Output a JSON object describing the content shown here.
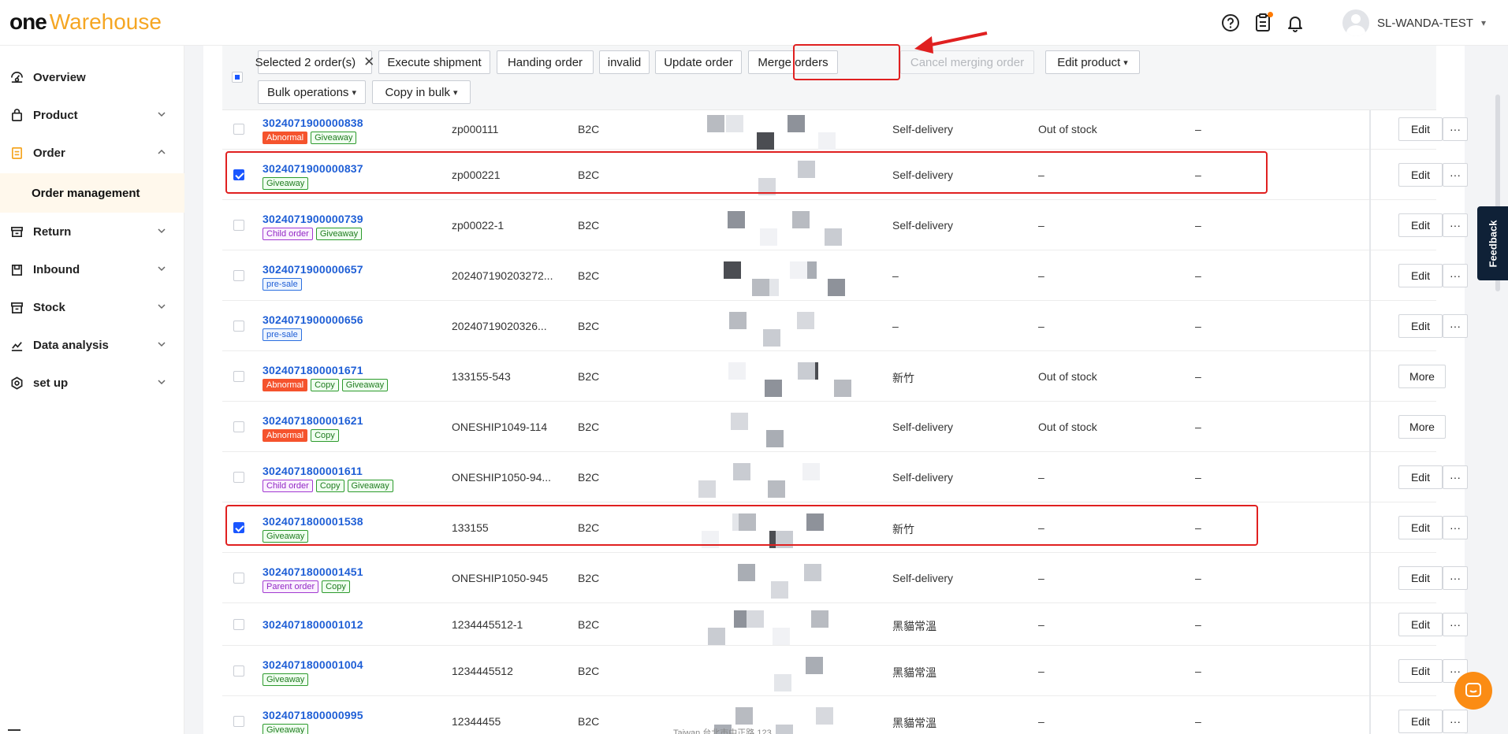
{
  "header": {
    "logo_one": "one",
    "logo_warehouse": "Warehouse",
    "user_name": "SL-WANDA-TEST"
  },
  "sidebar": {
    "items": [
      {
        "label": "Overview",
        "icon": "dashboard-icon"
      },
      {
        "label": "Product",
        "icon": "bag-icon"
      },
      {
        "label": "Order",
        "icon": "document-icon"
      },
      {
        "label": "Return",
        "icon": "return-box-icon"
      },
      {
        "label": "Inbound",
        "icon": "inbound-icon"
      },
      {
        "label": "Stock",
        "icon": "stock-icon"
      },
      {
        "label": "Data analysis",
        "icon": "chart-icon"
      },
      {
        "label": "set up",
        "icon": "gear-icon"
      }
    ],
    "sub_item": "Order management"
  },
  "toolbar": {
    "selected": "Selected 2 order(s)",
    "execute": "Execute shipment",
    "handing": "Handing order",
    "invalid": "invalid",
    "update": "Update order",
    "merge": "Merge orders",
    "cancel_merge": "Cancel merging order",
    "edit_product": "Edit product",
    "bulk_ops": "Bulk operations",
    "copy_bulk": "Copy in bulk"
  },
  "rows": [
    {
      "order": "3024071900000838",
      "tags": [
        "Abnormal",
        "Giveaway"
      ],
      "ref": "zp000111",
      "type": "B2C",
      "carrier": "Self-delivery",
      "stock": "Out of stock",
      "extra": "–",
      "action": "Edit"
    },
    {
      "order": "3024071900000837",
      "tags": [
        "Giveaway"
      ],
      "ref": "zp000221",
      "type": "B2C",
      "carrier": "Self-delivery",
      "stock": "–",
      "extra": "–",
      "action": "Edit"
    },
    {
      "order": "3024071900000739",
      "tags": [
        "Child order",
        "Giveaway"
      ],
      "ref": "zp00022-1",
      "type": "B2C",
      "carrier": "Self-delivery",
      "stock": "–",
      "extra": "–",
      "action": "Edit"
    },
    {
      "order": "3024071900000657",
      "tags": [
        "pre-sale"
      ],
      "ref": "202407190203272...",
      "type": "B2C",
      "carrier": "–",
      "stock": "–",
      "extra": "–",
      "action": "Edit"
    },
    {
      "order": "3024071900000656",
      "tags": [
        "pre-sale"
      ],
      "ref": "20240719020326...",
      "type": "B2C",
      "carrier": "–",
      "stock": "–",
      "extra": "–",
      "action": "Edit"
    },
    {
      "order": "3024071800001671",
      "tags": [
        "Abnormal",
        "Copy",
        "Giveaway"
      ],
      "ref": "133155-543",
      "type": "B2C",
      "carrier": "新竹",
      "stock": "Out of stock",
      "extra": "–",
      "action": "More"
    },
    {
      "order": "3024071800001621",
      "tags": [
        "Abnormal",
        "Copy"
      ],
      "ref": "ONESHIP1049-114",
      "type": "B2C",
      "carrier": "Self-delivery",
      "stock": "Out of stock",
      "extra": "–",
      "action": "More"
    },
    {
      "order": "3024071800001611",
      "tags": [
        "Child order",
        "Copy",
        "Giveaway"
      ],
      "ref": "ONESHIP1050-94...",
      "type": "B2C",
      "carrier": "Self-delivery",
      "stock": "–",
      "extra": "–",
      "action": "Edit"
    },
    {
      "order": "3024071800001538",
      "tags": [
        "Giveaway"
      ],
      "ref": "133155",
      "type": "B2C",
      "carrier": "新竹",
      "stock": "–",
      "extra": "–",
      "action": "Edit"
    },
    {
      "order": "3024071800001451",
      "tags": [
        "Parent order",
        "Copy"
      ],
      "ref": "ONESHIP1050-945",
      "type": "B2C",
      "carrier": "Self-delivery",
      "stock": "–",
      "extra": "–",
      "action": "Edit"
    },
    {
      "order": "3024071800001012",
      "tags": [],
      "ref": "1234445512-1",
      "type": "B2C",
      "carrier": "黑貓常溫",
      "stock": "–",
      "extra": "–",
      "action": "Edit"
    },
    {
      "order": "3024071800001004",
      "tags": [
        "Giveaway"
      ],
      "ref": "1234445512",
      "type": "B2C",
      "carrier": "黑貓常溫",
      "stock": "–",
      "extra": "–",
      "action": "Edit"
    },
    {
      "order": "3024071800000995",
      "tags": [
        "Giveaway"
      ],
      "ref": "12344455",
      "type": "B2C",
      "carrier": "黑貓常溫",
      "stock": "–",
      "extra": "–",
      "action": "Edit"
    }
  ],
  "address_snippet": "Taiwan 台北市中正路 123",
  "more_glyph": "···",
  "feedback": "Feedback",
  "colors": {
    "accent": "#f5a623",
    "link": "#1f5fd6",
    "highlight": "#e02020",
    "checkbox": "#1a56ff"
  }
}
